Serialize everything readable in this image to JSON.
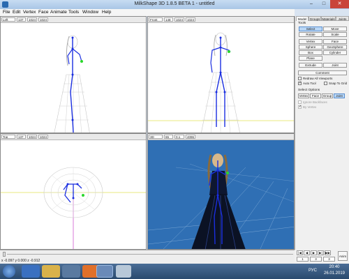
{
  "window": {
    "title": "MilkShape 3D 1.8.5 BETA 1 - untitled",
    "minimize": "–",
    "maximize": "□",
    "close": "✕"
  },
  "menu": [
    "File",
    "Edit",
    "Vertex",
    "Face",
    "Animate",
    "Tools",
    "Window",
    "Help"
  ],
  "viewports": {
    "left": {
      "view": "Left",
      "fields": [
        "137",
        "1024",
        "1024"
      ]
    },
    "front": {
      "view": "Front",
      "fields": [
        "148",
        "1024",
        "1024"
      ]
    },
    "top": {
      "view": "Top",
      "fields": [
        "137",
        "1024",
        "1024"
      ]
    },
    "threed": {
      "view": "3D",
      "fields": [
        "65",
        "0.1",
        "4096"
      ]
    }
  },
  "panel": {
    "tabs": [
      "Model",
      "Groups",
      "Materials",
      "Joints"
    ],
    "tools_label": "Tools",
    "tools": [
      "Select",
      "Move",
      "Rotate",
      "Scale",
      "Vertex",
      "Face",
      "Sphere",
      "GeoSphere",
      "Box",
      "Cylinder",
      "Plane",
      "Extrude",
      "Joint"
    ],
    "comment_label": "Comment",
    "checkboxes": {
      "redraw": "Redraw All Viewports",
      "autotool": "Auto Tool",
      "snap": "Snap To Grid"
    },
    "select_options_label": "Select Options",
    "select_modes": [
      "Vertex",
      "Face",
      "Group",
      "Joint"
    ],
    "ignore_backfaces": "Ignore Backfaces",
    "by_vertex": "By Vertex"
  },
  "status": {
    "coords": "x -0.097 y 0.000 z -0.912"
  },
  "anim": {
    "frame": "1",
    "start": "3",
    "end": "3",
    "button": "Anim"
  },
  "taskbar": {
    "lang": "РУС",
    "time": "20:40",
    "date": "26.01.2019"
  },
  "colors": {
    "viewport_3d_bg": "#2f6fb4",
    "accent": "#b9d6f5",
    "skeleton": "#1a2ee0"
  }
}
